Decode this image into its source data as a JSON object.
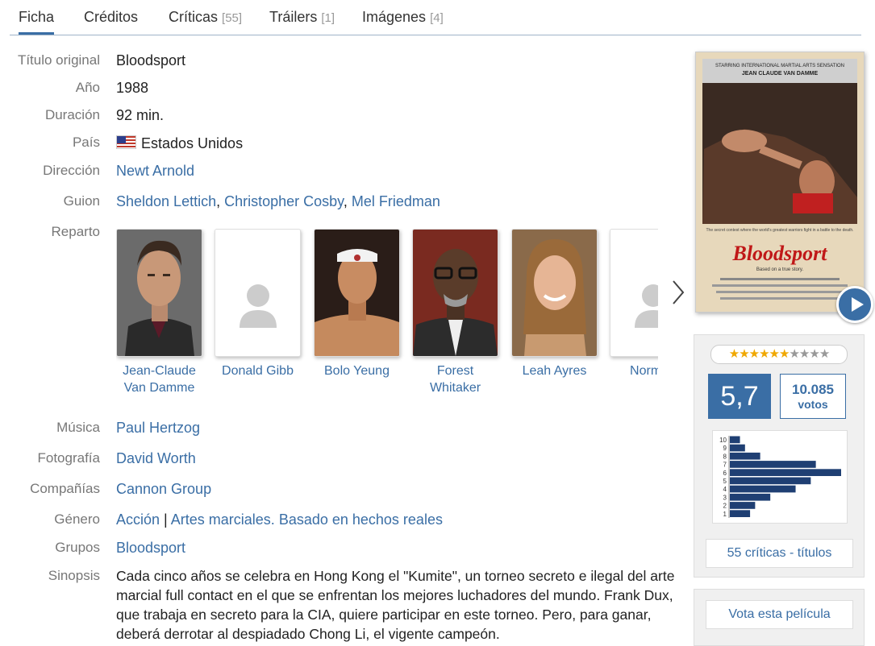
{
  "tabs": [
    {
      "label": "Ficha",
      "count": ""
    },
    {
      "label": "Créditos",
      "count": ""
    },
    {
      "label": "Críticas",
      "count": "[55]"
    },
    {
      "label": "Tráilers",
      "count": "[1]"
    },
    {
      "label": "Imágenes",
      "count": "[4]"
    }
  ],
  "info": {
    "original_title_label": "Título original",
    "original_title": "Bloodsport",
    "year_label": "Año",
    "year": "1988",
    "duration_label": "Duración",
    "duration": "92 min.",
    "country_label": "País",
    "country": "Estados Unidos",
    "country_flag_icon": "us-flag-icon",
    "director_label": "Dirección",
    "director": "Newt Arnold",
    "writers_label": "Guion",
    "writers": [
      "Sheldon Lettich",
      "Christopher Cosby",
      "Mel Friedman"
    ],
    "cast_label": "Reparto",
    "cast": [
      {
        "name1": "Jean-Claude",
        "name2": "Van Damme"
      },
      {
        "name1": "Donald Gibb",
        "name2": ""
      },
      {
        "name1": "Bolo Yeung",
        "name2": ""
      },
      {
        "name1": "Forest",
        "name2": "Whitaker"
      },
      {
        "name1": "Leah Ayres",
        "name2": ""
      },
      {
        "name1": "Norman",
        "name2": ""
      }
    ],
    "music_label": "Música",
    "music": "Paul Hertzog",
    "photo_label": "Fotografía",
    "photo": "David Worth",
    "companies_label": "Compañías",
    "companies": "Cannon Group",
    "genre_label": "Género",
    "genre1": "Acción",
    "genre_sep": "|",
    "genre2": "Artes marciales",
    "genre_sep2": ".",
    "genre3": "Basado en hechos reales",
    "groups_label": "Grupos",
    "groups": "Bloodsport",
    "synopsis_label": "Sinopsis",
    "synopsis": "Cada cinco años se celebra en Hong Kong el \"Kumite\", un torneo secreto e ilegal del arte marcial full contact en el que se enfrentan los mejores luchadores del mundo. Frank Dux, que trabaja en secreto para la CIA, quiere participar en este torneo. Pero, para ganar, deberá derrotar al despiadado Chong Li, el vigente campeón."
  },
  "poster": {
    "top_line1": "STARRING INTERNATIONAL MARTIAL ARTS SENSATION",
    "top_line2": "JEAN CLAUDE VAN DAMME",
    "tagline": "The secret contest where the world's greatest warriors fight in a battle to the death.",
    "title": "Bloodsport",
    "subtitle": "Based on a true story."
  },
  "rating": {
    "stars_on": 6,
    "stars_total": 10,
    "average": "5,7",
    "votes_count": "10.085",
    "votes_label": "votos",
    "histogram_labels": [
      "10",
      "9",
      "8",
      "7",
      "6",
      "5",
      "4",
      "3",
      "2",
      "1"
    ],
    "histogram_values": [
      2,
      3,
      6,
      17,
      22,
      16,
      13,
      8,
      5,
      4
    ],
    "reviews_button": "55 críticas - títulos",
    "vote_button": "Vota esta película"
  },
  "colors": {
    "accent": "#3a6ea5",
    "star": "#f0a800"
  }
}
